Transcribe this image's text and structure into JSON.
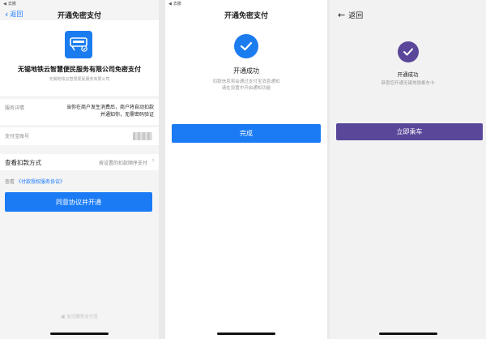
{
  "colors": {
    "alipay_blue": "#1a7bf5",
    "metro_purple": "#5a4799",
    "link_blue": "#1677ff"
  },
  "panel1": {
    "status_text": "去撤",
    "back_label": "返回",
    "title": "开通免密支付",
    "logo_icon": "metro-ticket-logo",
    "merchant_name": "无锡地铁云智慧便民服务有限公司免密支付",
    "merchant_company": "无锡地铁云智慧便民服务有限公司",
    "service_label": "服务详情",
    "service_text": "当你在商户发生消费后，商户将自动扣款并通知你，无需密码验证",
    "account_label": "支付宝账号",
    "method_label": "查看扣款方式",
    "method_value": "按设置的扣款顺序支付",
    "agreement_prefix": "查看",
    "agreement_link": "《付款授权服务协议》",
    "agree_button": "同意协议并开通",
    "footer_brand": "支付服务支付宝"
  },
  "panel2": {
    "status_text": "去撤",
    "title": "开通免密支付",
    "success_title": "开通成功",
    "success_desc_line1": "扣款信息将会通过支付宝消息通知",
    "success_desc_line2": "请在设置中开启通知功能",
    "done_button": "完成"
  },
  "panel3": {
    "back_label": "返回",
    "success_title": "开通成功",
    "success_desc": "恭喜您开通无锡地铁乘车卡",
    "ride_button": "立即乘车"
  }
}
